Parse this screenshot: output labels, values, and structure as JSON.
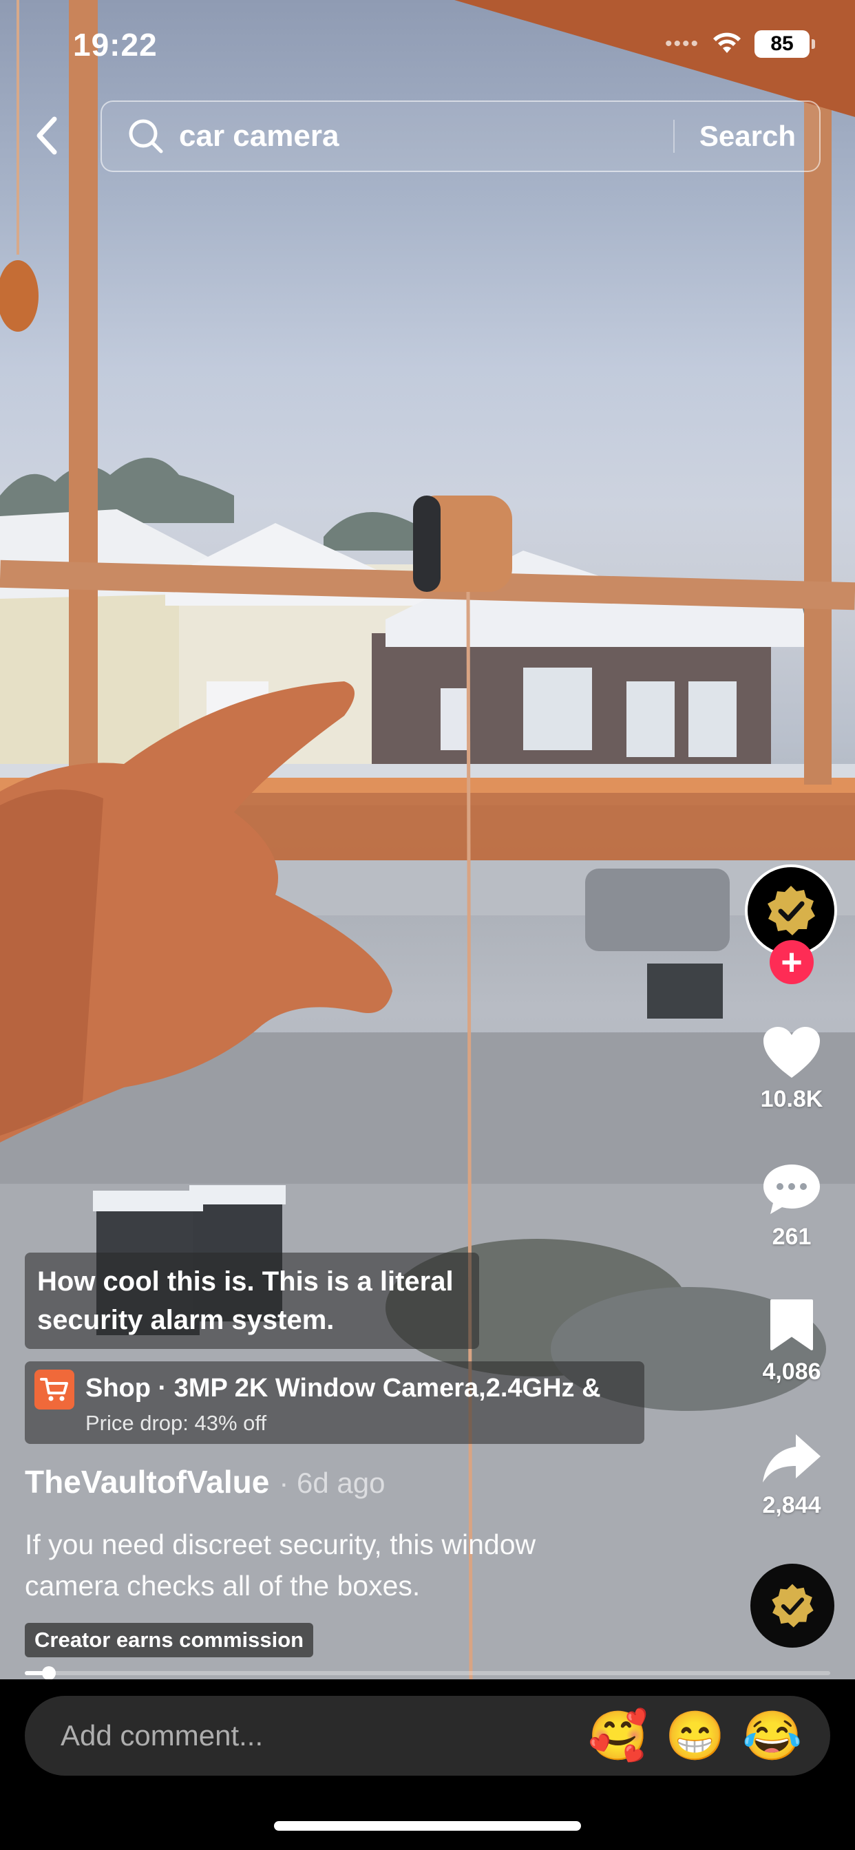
{
  "status_bar": {
    "time": "19:22",
    "signal": "••••",
    "battery": "85"
  },
  "search": {
    "query": "car camera",
    "button_label": "Search",
    "icons": {
      "back": "chevron-left-icon",
      "search": "magnifier-icon"
    }
  },
  "actions": {
    "likes": "10.8K",
    "comments": "261",
    "saves": "4,086",
    "shares": "2,844",
    "icons": [
      "heart-icon",
      "comment-bubble-icon",
      "bookmark-icon",
      "share-arrow-icon"
    ],
    "follow_plus": "+"
  },
  "post": {
    "caption": "How cool this is. This is a literal security alarm system.",
    "shop_title": "Shop · 3MP 2K Window Camera,2.4GHz &",
    "shop_subtitle": "Price drop: 43% off",
    "author": "TheVaultofValue",
    "time_ago": "· 6d ago",
    "description": "If you need discreet security, this window camera checks all of the boxes.",
    "commission_badge": "Creator earns commission",
    "progress_fraction": 0.03
  },
  "comment_bar": {
    "placeholder": "Add comment...",
    "emojis": [
      "🥰",
      "😁",
      "😂"
    ]
  },
  "colors": {
    "follow": "#fe2c55",
    "shop_icon": "#f0693a",
    "verified_gold": "#d8b14a",
    "comment_field": "#2a2a2a"
  }
}
